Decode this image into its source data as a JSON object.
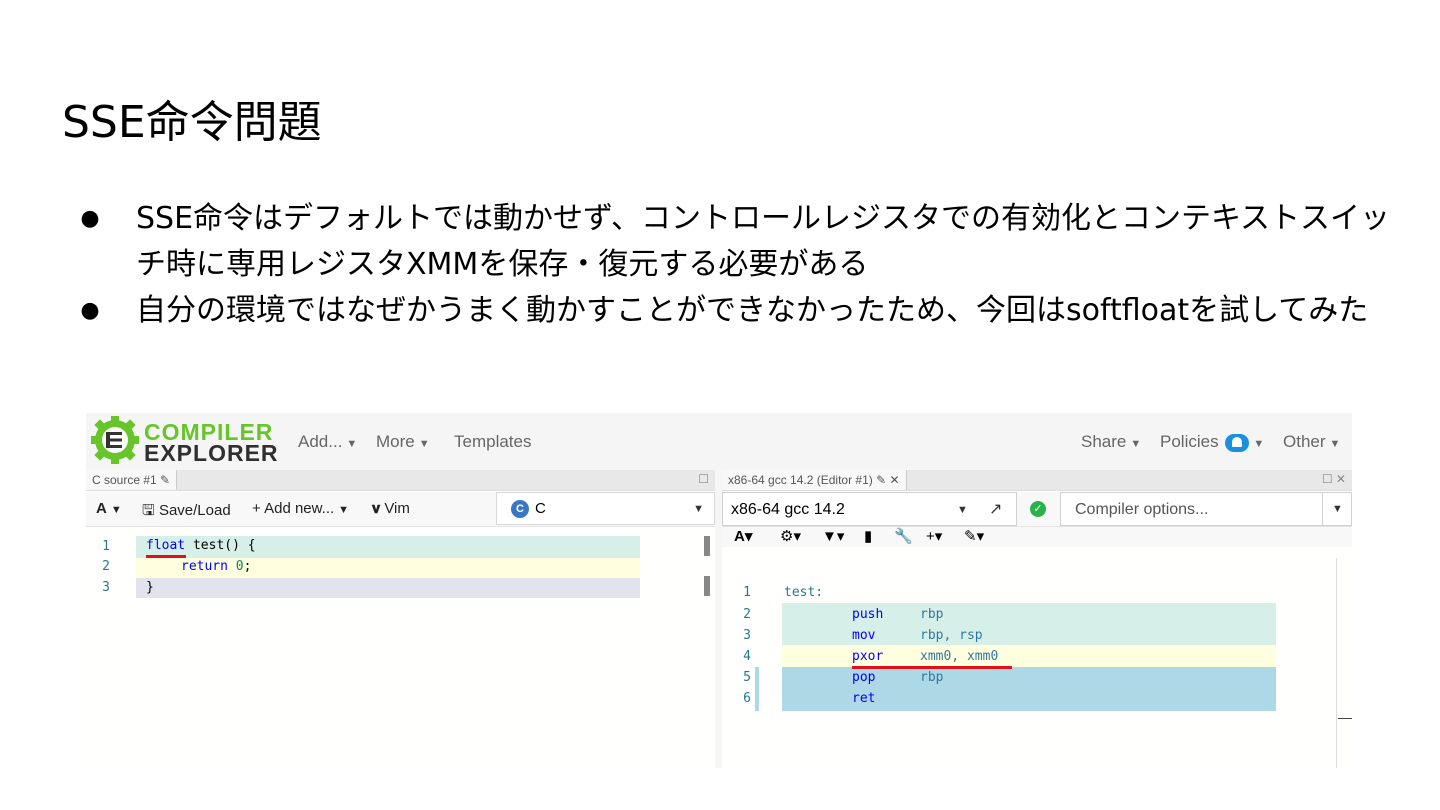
{
  "slide": {
    "title": "SSE命令問題",
    "bullets": [
      "SSE命令はデフォルトでは動かせず、コントロールレジスタでの有効化とコンテキストスイッチ時に専用レジスタXMMを保存・復元する必要がある",
      "自分の環境ではなぜかうまく動かすことができなかったため、今回はsoftfloatを試してみた"
    ]
  },
  "compiler_explorer": {
    "brand": {
      "line1": "COMPILER",
      "line2": "EXPLORER"
    },
    "nav": {
      "add": "Add...",
      "more": "More",
      "templates": "Templates",
      "share": "Share",
      "policies": "Policies",
      "other": "Other"
    },
    "source_panel": {
      "tab": "C source #1",
      "toolbar": {
        "font": "A",
        "save_load": "Save/Load",
        "add_new": "+ Add new...",
        "vim": "Vim",
        "language": "C"
      },
      "lines": [
        "1",
        "2",
        "3"
      ],
      "code": {
        "l1_kw": "float",
        "l1_rest": " test() {",
        "l2_kw": "return",
        "l2_num": "0",
        "l2_end": ";",
        "l3": "}"
      }
    },
    "asm_panel": {
      "tab": "x86-64 gcc 14.2 (Editor #1)",
      "compiler": "x86-64 gcc 14.2",
      "options_placeholder": "Compiler options...",
      "lines": [
        "1",
        "2",
        "3",
        "4",
        "5",
        "6"
      ],
      "asm": [
        {
          "label": "test:",
          "op": "",
          "args": ""
        },
        {
          "label": "",
          "op": "push",
          "args": "rbp"
        },
        {
          "label": "",
          "op": "mov",
          "args": "rbp, rsp"
        },
        {
          "label": "",
          "op": "pxor",
          "args": "xmm0, xmm0"
        },
        {
          "label": "",
          "op": "pop",
          "args": "rbp"
        },
        {
          "label": "",
          "op": "ret",
          "args": ""
        }
      ]
    }
  },
  "colors": {
    "accent_green": "#67c52a",
    "underline_red": "#e0101a",
    "hl_green": "#d6efe9",
    "hl_yellow": "#ffffe0",
    "hl_blue": "#add8e6"
  }
}
